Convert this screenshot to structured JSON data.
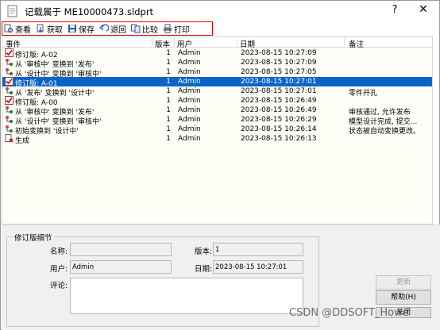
{
  "window": {
    "title": "记载属于 ME10000473.sldprt",
    "help_label": "?",
    "close_label": "✕"
  },
  "toolbar": {
    "buttons": [
      {
        "label": "查看",
        "icon": "view-icon"
      },
      {
        "label": "获取",
        "icon": "get-icon"
      },
      {
        "label": "保存",
        "icon": "save-icon"
      },
      {
        "label": "退回",
        "icon": "rollback-icon"
      },
      {
        "label": "比较",
        "icon": "compare-icon"
      },
      {
        "label": "打印",
        "icon": "print-icon"
      }
    ]
  },
  "table": {
    "columns": [
      "事件",
      "版本",
      "用户",
      "日期",
      "备注"
    ],
    "rows": [
      {
        "event": "修订版: A-02",
        "version": "1",
        "user": "Admin",
        "date": "2023-08-15 10:27:09",
        "note": "",
        "icon": "checkmark-icon",
        "selected": false
      },
      {
        "event": "从 '审核中' 变换到 '发布'",
        "version": "1",
        "user": "Admin",
        "date": "2023-08-15 10:27:09",
        "note": "",
        "icon": "transition-icon",
        "selected": false
      },
      {
        "event": "从 '设计中' 变换到 '审核中'",
        "version": "1",
        "user": "Admin",
        "date": "2023-08-15 10:27:05",
        "note": "",
        "icon": "transition-icon",
        "selected": false
      },
      {
        "event": "修订版: A-01",
        "version": "1",
        "user": "Admin",
        "date": "2023-08-15 10:27:01",
        "note": "",
        "icon": "checkmark-icon",
        "selected": true
      },
      {
        "event": "从 '发布' 变换到 '设计中'",
        "version": "1",
        "user": "Admin",
        "date": "2023-08-15 10:27:01",
        "note": "零件开孔",
        "icon": "transition-icon",
        "selected": false
      },
      {
        "event": "修订版: A-00",
        "version": "1",
        "user": "Admin",
        "date": "2023-08-15 10:26:49",
        "note": "",
        "icon": "checkmark-icon",
        "selected": false
      },
      {
        "event": "从 '审核中' 变换到 '发布'",
        "version": "1",
        "user": "Admin",
        "date": "2023-08-15 10:26:49",
        "note": "审核通过, 允许发布",
        "icon": "transition-icon",
        "selected": false
      },
      {
        "event": "从 '设计中' 变换到 '审核中'",
        "version": "1",
        "user": "Admin",
        "date": "2023-08-15 10:26:29",
        "note": "模型设计完成, 提交...",
        "icon": "transition-icon",
        "selected": false
      },
      {
        "event": "初始变换到 '设计中'",
        "version": "1",
        "user": "Admin",
        "date": "2023-08-15 10:26:14",
        "note": "状态被自动变换更改。",
        "icon": "transition-icon",
        "selected": false
      },
      {
        "event": "生成",
        "version": "1",
        "user": "Admin",
        "date": "2023-08-15 10:26:13",
        "note": "",
        "icon": "create-icon",
        "selected": false
      }
    ]
  },
  "details": {
    "group_title": "修订版细节",
    "name_label": "名称:",
    "name_value": "",
    "version_label": "版本:",
    "version_value": "1",
    "user_label": "用户:",
    "user_value": "Admin",
    "date_label": "日期:",
    "date_value": "2023-08-15 10:27:01",
    "comment_label": "评论:",
    "comment_value": ""
  },
  "buttons": {
    "update": "更新",
    "help": "帮助(H)",
    "close": "关闭"
  },
  "watermark": "CSDN @DDSOFT_Howe",
  "colors": {
    "selection": "#0a64c8",
    "highlight_border": "#e00000",
    "list_bg": "#fffff8"
  }
}
